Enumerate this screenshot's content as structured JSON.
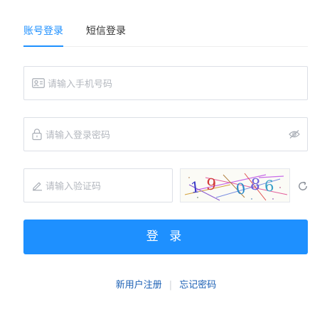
{
  "tabs": [
    {
      "label": "账号登录",
      "active": true
    },
    {
      "label": "短信登录",
      "active": false
    }
  ],
  "phone": {
    "placeholder": "请输入手机号码",
    "icon": "id-card-icon"
  },
  "password": {
    "placeholder": "请输入登录密码",
    "icon": "lock-icon",
    "toggle_icon": "eye-hidden-icon"
  },
  "captcha": {
    "placeholder": "请输入验证码",
    "icon": "pencil-icon",
    "image_digits": [
      "1",
      "9",
      "0",
      "8",
      "6"
    ],
    "refresh_icon": "refresh-icon"
  },
  "login_button": "登 录",
  "footer": {
    "register": "新用户注册",
    "separator": "|",
    "forgot": "忘记密码"
  },
  "colors": {
    "accent": "#1e90ff",
    "link": "#1a5fb4",
    "border": "#dcdfe6",
    "placeholder": "#b4b8bf"
  }
}
